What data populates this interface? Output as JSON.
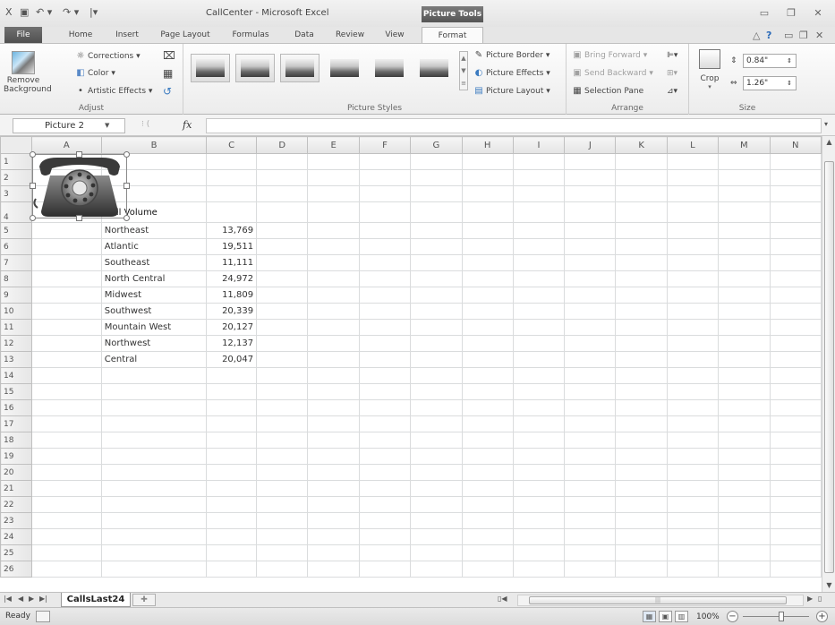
{
  "window": {
    "title": "CallCenter - Microsoft Excel",
    "context_label": "Picture Tools"
  },
  "qat": {
    "excel_icon": "X",
    "save": "▣",
    "undo": "↶ ▾",
    "redo": "↷ ▾",
    "customize": "|▾"
  },
  "tabs": {
    "file": "File",
    "home": "Home",
    "insert": "Insert",
    "page_layout": "Page Layout",
    "formulas": "Formulas",
    "data": "Data",
    "review": "Review",
    "view": "View",
    "format": "Format"
  },
  "ribbon": {
    "adjust": {
      "label": "Adjust",
      "remove_background": [
        "Remove",
        "Background"
      ],
      "corrections": "Corrections ▾",
      "color": "Color ▾",
      "artistic_effects": "Artistic Effects ▾"
    },
    "picture_styles": {
      "label": "Picture Styles",
      "picture_border": "Picture Border ▾",
      "picture_effects": "Picture Effects ▾",
      "picture_layout": "Picture Layout ▾"
    },
    "arrange": {
      "label": "Arrange",
      "bring_forward": "Bring Forward ▾",
      "send_backward": "Send Backward ▾",
      "selection_pane": "Selection Pane"
    },
    "size": {
      "label": "Size",
      "crop": "Crop",
      "height": "0.84\"",
      "width": "1.26\""
    }
  },
  "formula_bar": {
    "name_box": "Picture 2",
    "fx": "fx",
    "formula": ""
  },
  "sheet": {
    "columns": [
      "A",
      "B",
      "C",
      "D",
      "E",
      "F",
      "G",
      "H",
      "I",
      "J",
      "K",
      "L",
      "M",
      "N"
    ],
    "rows": [
      "1",
      "2",
      "3",
      "4",
      "5",
      "6",
      "7",
      "8",
      "9",
      "10",
      "11",
      "12",
      "13",
      "14",
      "15",
      "16",
      "17",
      "18",
      "19",
      "20",
      "21",
      "22",
      "23",
      "24",
      "25",
      "26"
    ],
    "title": "Call Volume",
    "data": [
      {
        "region": "Northeast",
        "calls": "13,769"
      },
      {
        "region": "Atlantic",
        "calls": "19,511"
      },
      {
        "region": "Southeast",
        "calls": "11,111"
      },
      {
        "region": "North Central",
        "calls": "24,972"
      },
      {
        "region": "Midwest",
        "calls": "11,809"
      },
      {
        "region": "Southwest",
        "calls": "20,339"
      },
      {
        "region": "Mountain West",
        "calls": "20,127"
      },
      {
        "region": "Northwest",
        "calls": "12,137"
      },
      {
        "region": "Central",
        "calls": "20,047"
      }
    ]
  },
  "sheet_tabs": {
    "active": "CallsLast24"
  },
  "status": {
    "text": "Ready",
    "zoom": "100%"
  },
  "icons": {
    "remove_background": "remove-background-icon",
    "corrections": "sun-icon",
    "color": "color-palette-icon",
    "artistic": "artistic-effects-icon",
    "phone_picture": "telephone-picture"
  }
}
